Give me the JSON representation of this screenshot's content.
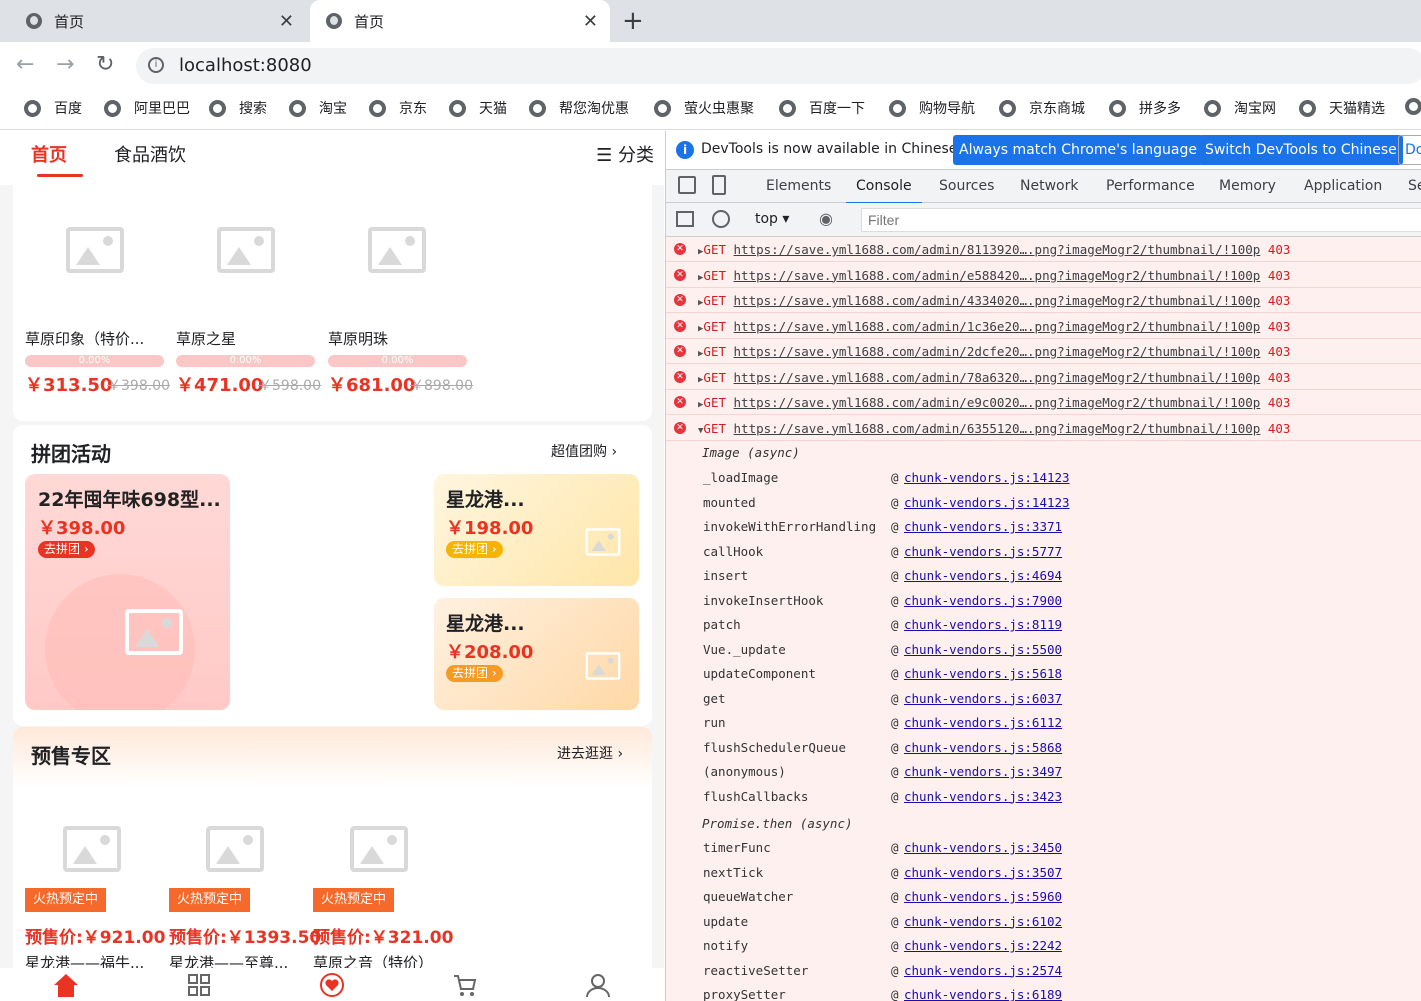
{
  "browser": {
    "tabs": [
      {
        "title": "首页"
      },
      {
        "title": "首页"
      }
    ],
    "url": "localhost:8080",
    "bookmarks": [
      "百度",
      "阿里巴巴",
      "搜索",
      "淘宝",
      "京东",
      "天猫",
      "帮您淘优惠",
      "萤火虫惠聚",
      "百度一下",
      "购物导航",
      "京东商城",
      "拼多多",
      "淘宝网",
      "天猫精选"
    ]
  },
  "app": {
    "tabs": [
      "首页",
      "食品酒饮"
    ],
    "category_label": "分类",
    "products": [
      {
        "name": "草原印象（特价...",
        "progress": "0.00%",
        "price": "￥313.50",
        "old": "￥398.00"
      },
      {
        "name": "草原之星",
        "progress": "0.00%",
        "price": "￥471.00",
        "old": "￥598.00"
      },
      {
        "name": "草原明珠",
        "progress": "0.00%",
        "price": "￥681.00",
        "old": "￥898.00"
      }
    ],
    "group": {
      "title": "拼团活动",
      "more": "超值团购",
      "items": [
        {
          "title": "22年囤年味698型...",
          "price": "￥398.00",
          "btn": "去拼团"
        },
        {
          "title": "星龙港...",
          "price": "￥198.00",
          "btn": "去拼团"
        },
        {
          "title": "星龙港...",
          "price": "￥208.00",
          "btn": "去拼团"
        }
      ]
    },
    "presale": {
      "title": "预售专区",
      "more": "进去逛逛",
      "items": [
        {
          "badge": "火热预定中",
          "price": "预售价:￥921.00",
          "name": "星龙港——福牛..."
        },
        {
          "badge": "火热预定中",
          "price": "预售价:￥1393.50",
          "name": "星龙港——至尊..."
        },
        {
          "badge": "火热预定中",
          "price": "预售价:￥321.00",
          "name": "草原之音（特价）"
        }
      ]
    }
  },
  "devtools": {
    "info": "DevTools is now available in Chinese!",
    "btn_match": "Always match Chrome's language",
    "btn_switch": "Switch DevTools to Chinese",
    "btn_dont": "Do",
    "tabs": [
      "Elements",
      "Console",
      "Sources",
      "Network",
      "Performance",
      "Memory",
      "Application",
      "Se"
    ],
    "context": "top",
    "filter_placeholder": "Filter",
    "errors": [
      {
        "method": "GET",
        "url": "https://save.yml1688.com/admin/8113920….png?imageMogr2/thumbnail/!100p",
        "code": "403"
      },
      {
        "method": "GET",
        "url": "https://save.yml1688.com/admin/e588420….png?imageMogr2/thumbnail/!100p",
        "code": "403"
      },
      {
        "method": "GET",
        "url": "https://save.yml1688.com/admin/4334020….png?imageMogr2/thumbnail/!100p",
        "code": "403"
      },
      {
        "method": "GET",
        "url": "https://save.yml1688.com/admin/1c36e20….png?imageMogr2/thumbnail/!100p",
        "code": "403"
      },
      {
        "method": "GET",
        "url": "https://save.yml1688.com/admin/2dcfe20….png?imageMogr2/thumbnail/!100p",
        "code": "403"
      },
      {
        "method": "GET",
        "url": "https://save.yml1688.com/admin/78a6320….png?imageMogr2/thumbnail/!100p",
        "code": "403"
      },
      {
        "method": "GET",
        "url": "https://save.yml1688.com/admin/e9c0020….png?imageMogr2/thumbnail/!100p",
        "code": "403"
      },
      {
        "method": "GET",
        "url": "https://save.yml1688.com/admin/6355120….png?imageMogr2/thumbnail/!100p",
        "code": "403"
      }
    ],
    "async1": "Image (async)",
    "stack1": [
      {
        "fn": "_loadImage",
        "src": "chunk-vendors.js:14123"
      },
      {
        "fn": "mounted",
        "src": "chunk-vendors.js:14123"
      },
      {
        "fn": "invokeWithErrorHandling",
        "src": "chunk-vendors.js:3371"
      },
      {
        "fn": "callHook",
        "src": "chunk-vendors.js:5777"
      },
      {
        "fn": "insert",
        "src": "chunk-vendors.js:4694"
      },
      {
        "fn": "invokeInsertHook",
        "src": "chunk-vendors.js:7900"
      },
      {
        "fn": "patch",
        "src": "chunk-vendors.js:8119"
      },
      {
        "fn": "Vue._update",
        "src": "chunk-vendors.js:5500"
      },
      {
        "fn": "updateComponent",
        "src": "chunk-vendors.js:5618"
      },
      {
        "fn": "get",
        "src": "chunk-vendors.js:6037"
      },
      {
        "fn": "run",
        "src": "chunk-vendors.js:6112"
      },
      {
        "fn": "flushSchedulerQueue",
        "src": "chunk-vendors.js:5868"
      },
      {
        "fn": "(anonymous)",
        "src": "chunk-vendors.js:3497"
      },
      {
        "fn": "flushCallbacks",
        "src": "chunk-vendors.js:3423"
      }
    ],
    "async2": "Promise.then (async)",
    "stack2": [
      {
        "fn": "timerFunc",
        "src": "chunk-vendors.js:3450"
      },
      {
        "fn": "nextTick",
        "src": "chunk-vendors.js:3507"
      },
      {
        "fn": "queueWatcher",
        "src": "chunk-vendors.js:5960"
      },
      {
        "fn": "update",
        "src": "chunk-vendors.js:6102"
      },
      {
        "fn": "notify",
        "src": "chunk-vendors.js:2242"
      },
      {
        "fn": "reactiveSetter",
        "src": "chunk-vendors.js:2574"
      },
      {
        "fn": "proxySetter",
        "src": "chunk-vendors.js:6189"
      }
    ]
  }
}
